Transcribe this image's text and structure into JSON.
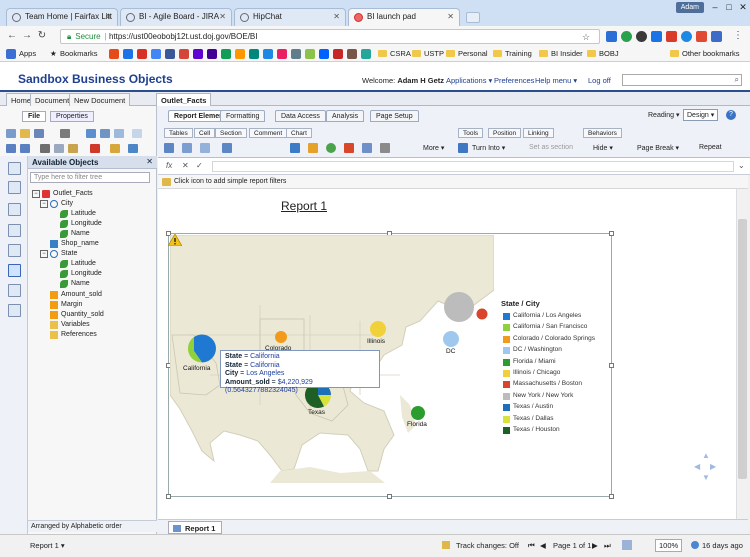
{
  "browser": {
    "tabs": [
      {
        "title": "Team Home | Fairfax Litt"
      },
      {
        "title": "BI - Agile Board - JIRA"
      },
      {
        "title": "HipChat"
      },
      {
        "title": "BI launch pad"
      }
    ],
    "user_badge": "Adam",
    "security_label": "Secure",
    "url": "https://ust00eobobj12t.ust.doj.gov/BOE/BI",
    "bookmarks": [
      "Apps",
      "Bookmarks",
      "CSRA",
      "USTP",
      "Personal",
      "Training",
      "BI Insider",
      "BOBJ",
      "Other bookmarks"
    ]
  },
  "app": {
    "title": "Sandbox Business Objects",
    "welcome_prefix": "Welcome:",
    "user": "Adam H Getz",
    "links": [
      "Applications ▾",
      "Preferences",
      "Help menu ▾",
      "Log off"
    ],
    "doc_tabs": [
      "Home",
      "Documents",
      "New Document",
      "Outlet_Facts"
    ]
  },
  "left_panel": {
    "tabs": [
      "File",
      "Properties"
    ],
    "header": "Available Objects",
    "filter_placeholder": "Type here to filter tree",
    "tree": [
      {
        "label": "Outlet_Facts",
        "level": 0
      },
      {
        "label": "City",
        "level": 1
      },
      {
        "label": "Latitude",
        "level": 2
      },
      {
        "label": "Longitude",
        "level": 2
      },
      {
        "label": "Name",
        "level": 2
      },
      {
        "label": "Shop_name",
        "level": 1
      },
      {
        "label": "State",
        "level": 1
      },
      {
        "label": "Latitude",
        "level": 2
      },
      {
        "label": "Longitude",
        "level": 2
      },
      {
        "label": "Name",
        "level": 2
      },
      {
        "label": "Amount_sold",
        "level": 1
      },
      {
        "label": "Margin",
        "level": 1
      },
      {
        "label": "Quantity_sold",
        "level": 1
      },
      {
        "label": "Variables",
        "level": 1
      },
      {
        "label": "References",
        "level": 1
      }
    ],
    "arrange": "Arranged by Alphabetic order"
  },
  "ribbon": {
    "tabs": [
      "Report Elements",
      "Formatting",
      "Data Access",
      "Analysis",
      "Page Setup"
    ],
    "modes": [
      "Reading ▾",
      "Design ▾"
    ],
    "subtabs": [
      "Tables",
      "Cell",
      "Section",
      "Comment",
      "Chart",
      "Tools",
      "Position",
      "Linking",
      "Behaviors"
    ],
    "buttons": [
      "More ▾",
      "Turn Into ▾",
      "Set as section",
      "Hide ▾",
      "Page Break ▾",
      "Repeat"
    ]
  },
  "filter_bar": "Click icon to add simple report filters",
  "report": {
    "title": "Report 1",
    "legend_title": "State / City",
    "legend": [
      {
        "label": "California / Los Angeles",
        "color": "#1f78d1"
      },
      {
        "label": "California / San Francisco",
        "color": "#8fd13a"
      },
      {
        "label": "Colorado / Colorado Springs",
        "color": "#f19a1b"
      },
      {
        "label": "DC / Washington",
        "color": "#9ec8ee"
      },
      {
        "label": "Florida / Miami",
        "color": "#2a9d2e"
      },
      {
        "label": "Illinois / Chicago",
        "color": "#f0d13a"
      },
      {
        "label": "Massachusetts / Boston",
        "color": "#d8452a"
      },
      {
        "label": "New York / New York",
        "color": "#bcbcbc"
      },
      {
        "label": "Texas / Austin",
        "color": "#1d6fb8"
      },
      {
        "label": "Texas / Dallas",
        "color": "#d9e23b"
      },
      {
        "label": "Texas / Houston",
        "color": "#1e5f25"
      }
    ],
    "city_labels": [
      "Colorado",
      "Illinois",
      "California",
      "Texas",
      "Florida",
      "DC"
    ],
    "tooltip": {
      "lines": [
        {
          "key": "State",
          "value": "California"
        },
        {
          "key": "State",
          "value": "California"
        },
        {
          "key": "City",
          "value": "Los Angeles"
        },
        {
          "key": "Amount_sold",
          "value": "$4,220,929 (0.5643277882324045)"
        }
      ]
    },
    "sheet_tab": "Report 1"
  },
  "status": {
    "report_selector": "Report 1 ▾",
    "track_changes": "Track changes: Off",
    "page": "Page 1 of 1",
    "zoom": "100%",
    "refresh": "16 days ago"
  }
}
